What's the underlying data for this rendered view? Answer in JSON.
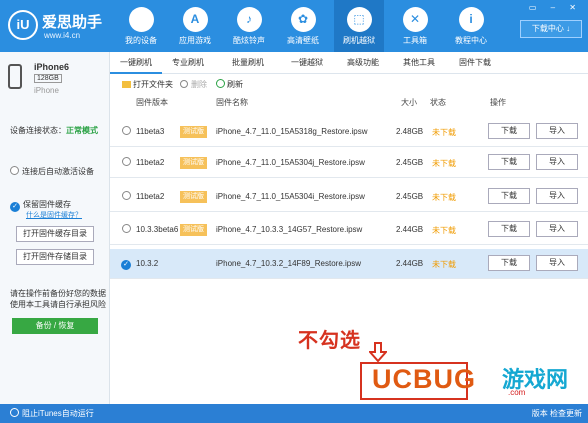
{
  "app": {
    "title": "爱思助手",
    "url": "www.i4.cn",
    "logo_mark": "iU"
  },
  "nav": {
    "items": [
      {
        "label": "我的设备",
        "icon": ""
      },
      {
        "label": "应用游戏",
        "icon": "A"
      },
      {
        "label": "酷炫铃声",
        "icon": "♪"
      },
      {
        "label": "高清壁纸",
        "icon": "✿"
      },
      {
        "label": "刷机越狱",
        "icon": "⬚"
      },
      {
        "label": "工具箱",
        "icon": "✕"
      },
      {
        "label": "教程中心",
        "icon": "i"
      }
    ],
    "download_center": "下载中心 ↓"
  },
  "device": {
    "name": "iPhone6",
    "capacity": "128GB",
    "model": "iPhone"
  },
  "sidebar": {
    "connection_label": "设备连接状态：",
    "connection_value": "正常模式",
    "auto_activate": "连接后自动激活设备",
    "keep_firmware": "保留固件缓存",
    "what_is_cache": "什么是固件缓存？",
    "open_cache_dir": "打开固件缓存目录",
    "open_store_dir": "打开固件存储目录",
    "warning_line1": "请在操作前备份好您的数据",
    "warning_line2": "使用本工具请自行承担风险",
    "backup_button": "备份 / 恢复"
  },
  "tabs": [
    "一键刷机",
    "专业刷机",
    "批量刷机",
    "一键越狱",
    "高级功能",
    "其他工具",
    "固件下载"
  ],
  "toolbar": {
    "open_folder": "打开文件夹",
    "delete": "删除",
    "refresh": "刷新"
  },
  "columns": {
    "version": "固件版本",
    "name": "固件名称",
    "size": "大小",
    "status": "状态",
    "action": "操作"
  },
  "firmware_rows": [
    {
      "version": "11beta3",
      "badge": "测试版",
      "name": "iPhone_4.7_11.0_15A5318g_Restore.ipsw",
      "size": "2.48GB",
      "status": "未下载",
      "download": "下载",
      "import": "导入",
      "selected": false
    },
    {
      "version": "11beta2",
      "badge": "测试版",
      "name": "iPhone_4.7_11.0_15A5304j_Restore.ipsw",
      "size": "2.45GB",
      "status": "未下载",
      "download": "下载",
      "import": "导入",
      "selected": false
    },
    {
      "version": "11beta2",
      "badge": "测试版",
      "name": "iPhone_4.7_11.0_15A5304i_Restore.ipsw",
      "size": "2.45GB",
      "status": "未下载",
      "download": "下载",
      "import": "导入",
      "selected": false
    },
    {
      "version": "10.3.3beta6",
      "badge": "测试版",
      "name": "iPhone_4.7_10.3.3_14G57_Restore.ipsw",
      "size": "2.44GB",
      "status": "未下载",
      "download": "下载",
      "import": "导入",
      "selected": false
    },
    {
      "version": "10.3.2",
      "badge": "",
      "name": "iPhone_4.7_10.3.2_14F89_Restore.ipsw",
      "size": "2.44GB",
      "status": "未下载",
      "download": "下载",
      "import": "导入",
      "selected": true
    }
  ],
  "annotation": {
    "text": "不勾选",
    "color": "#d6321f"
  },
  "watermark": {
    "latin": "UCBUG",
    "chinese": "游戏网",
    "url": ".com"
  },
  "footer": {
    "left": "阻止iTunes自动运行",
    "right": "版本   检查更新"
  },
  "colors": {
    "header": "#2b8ee0",
    "accent": "#1a7fd6",
    "status_ok": "#2ba245",
    "status_pending": "#f09b00"
  }
}
